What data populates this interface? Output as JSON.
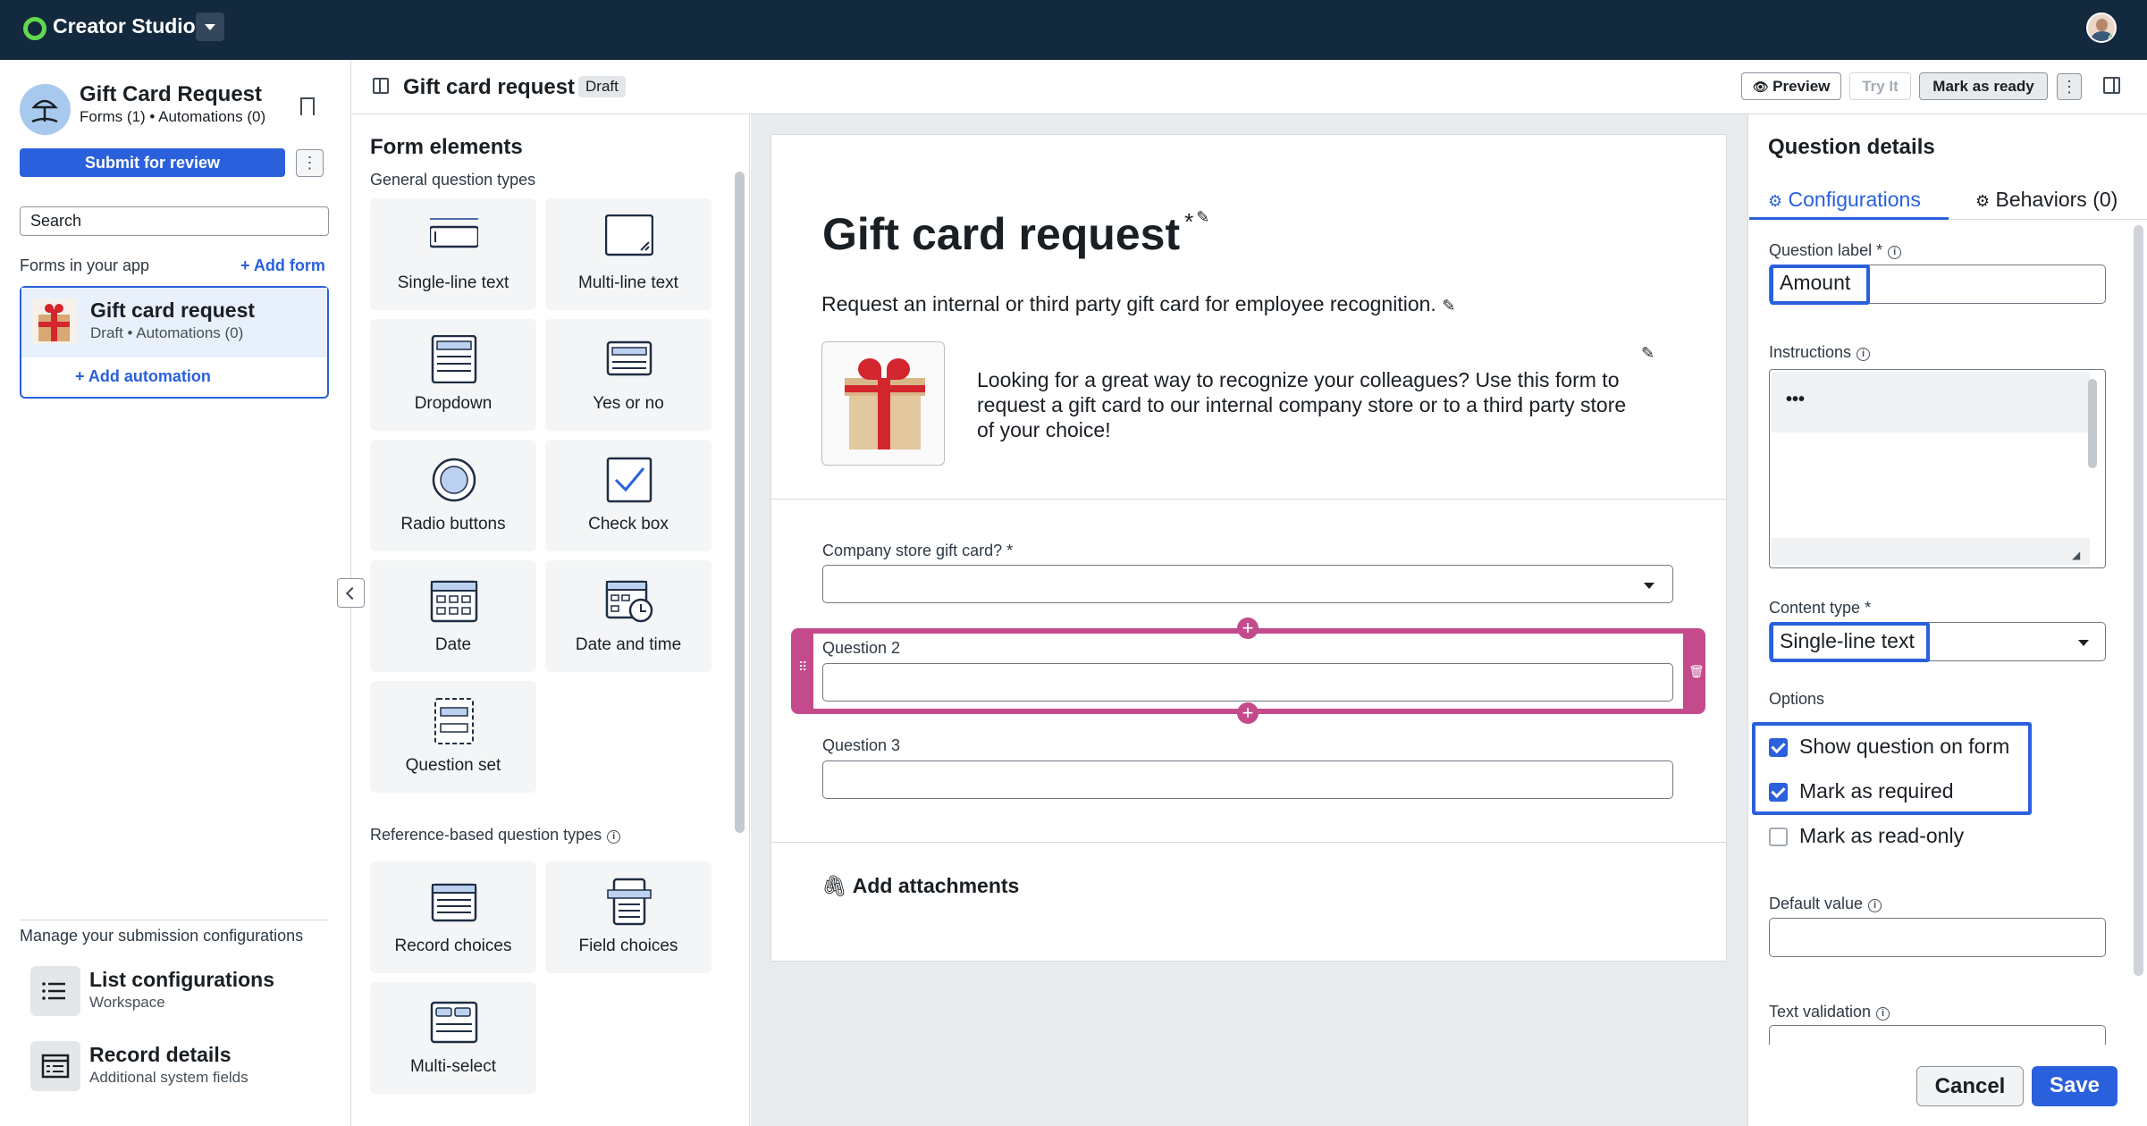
{
  "topbar": {
    "brand": "Creator Studio"
  },
  "app": {
    "title": "Gift Card Request",
    "subtitle": "Forms (1) • Automations (0)",
    "submit_label": "Submit for review",
    "kebab": "⋮",
    "search_placeholder": "Search",
    "forms_heading": "Forms in your app",
    "add_form": "+ Add form",
    "form_item": {
      "title": "Gift card request",
      "subtitle": "Draft • Automations (0)"
    },
    "add_automation": "+ Add automation",
    "manage_heading": "Manage your submission configurations",
    "manage_items": [
      {
        "title": "List configurations",
        "subtitle": "Workspace"
      },
      {
        "title": "Record details",
        "subtitle": "Additional system fields"
      }
    ]
  },
  "header": {
    "title": "Gift card request",
    "status": "Draft",
    "preview": "Preview",
    "try_it": "Try It",
    "mark_ready": "Mark as ready",
    "kebab": "⋮"
  },
  "palette": {
    "title": "Form elements",
    "general_heading": "General question types",
    "general": [
      "Single-line text",
      "Multi-line text",
      "Dropdown",
      "Yes or no",
      "Radio buttons",
      "Check box",
      "Date",
      "Date and time",
      "Question set"
    ],
    "reference_heading": "Reference-based question types",
    "reference": [
      "Record choices",
      "Field choices",
      "Multi-select"
    ]
  },
  "form": {
    "title": "Gift card request",
    "required_mark": "*",
    "description": "Request an internal or third party gift card for employee recognition.",
    "body": "Looking for a great way to recognize your colleagues? Use this form to request a gift card to our internal company store or to a third party store of your choice!",
    "questions": [
      {
        "label": "Company store gift card?",
        "required": "*"
      },
      {
        "label": "Question 2"
      },
      {
        "label": "Question 3"
      }
    ],
    "plus": "+",
    "attachments": "Add attachments"
  },
  "details": {
    "title": "Question details",
    "tab_config": "Configurations",
    "tab_behaviors": "Behaviors (0)",
    "question_label": "Question label",
    "question_value": "Amount",
    "instructions": "Instructions",
    "instructions_toolbar": "•••",
    "content_type": "Content type",
    "content_value": "Single-line text",
    "options_heading": "Options",
    "options": [
      {
        "label": "Show question on form",
        "checked": true
      },
      {
        "label": "Mark as required",
        "checked": true
      },
      {
        "label": "Mark as read-only",
        "checked": false
      }
    ],
    "default_value": "Default value",
    "text_validation": "Text validation",
    "required_mark": "*",
    "info_mark": "i",
    "cancel": "Cancel",
    "save": "Save"
  },
  "colors": {
    "topbar": "#13293d",
    "accent": "#2a60dc",
    "selection": "#c34b8c",
    "logo": "#62d84e"
  }
}
